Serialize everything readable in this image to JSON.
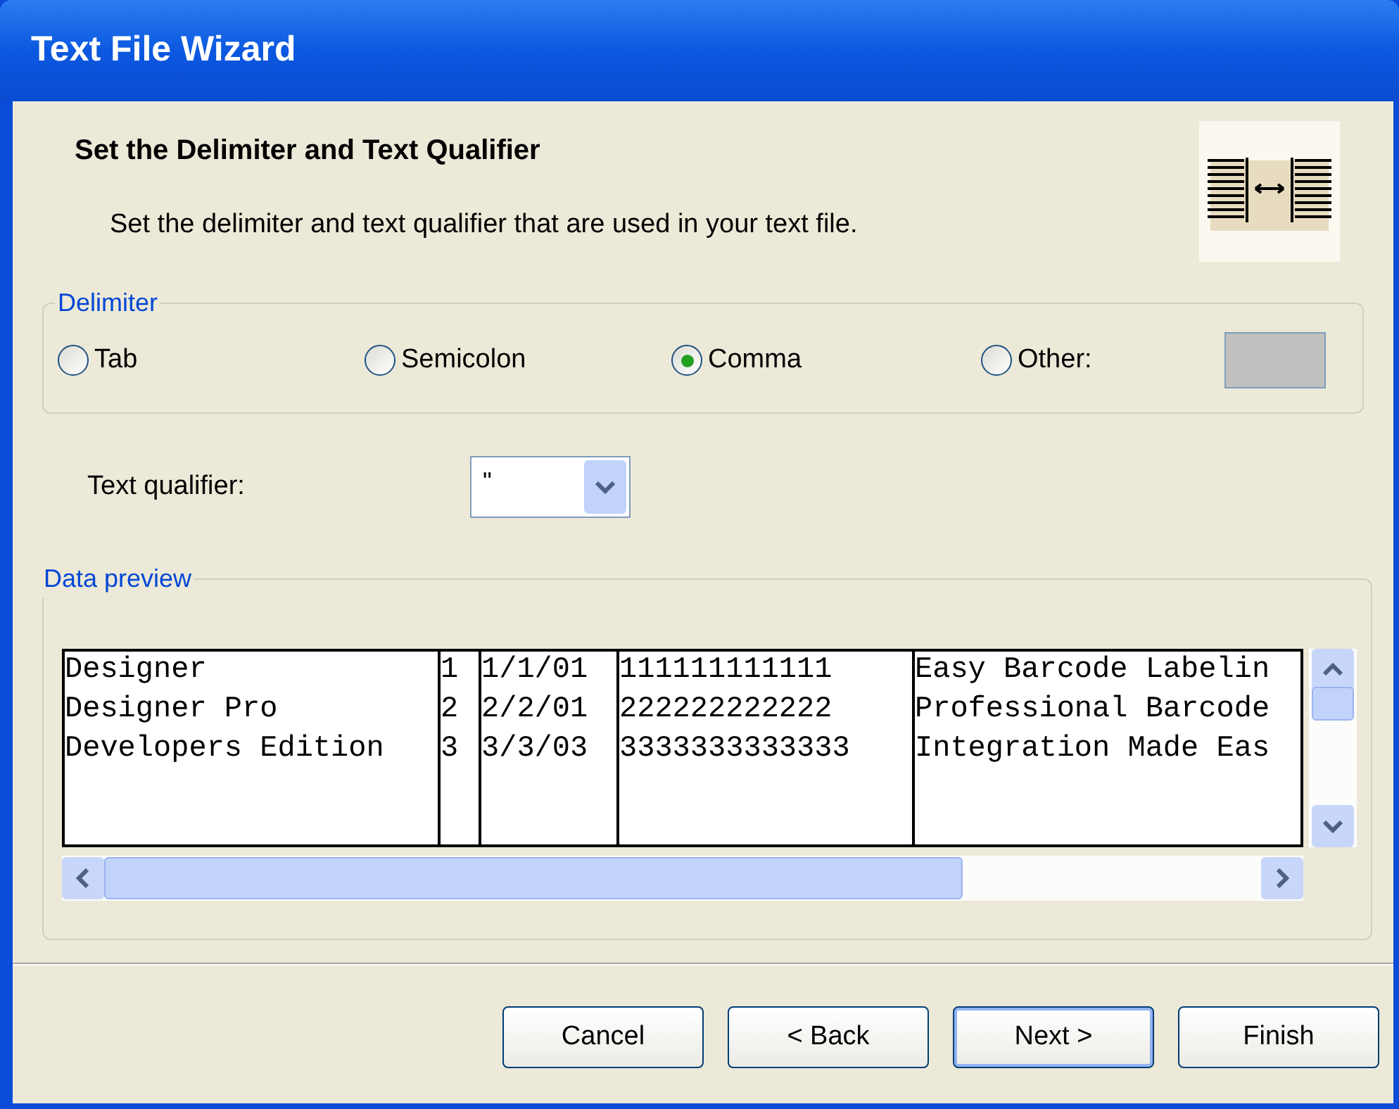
{
  "window": {
    "title": "Text File Wizard"
  },
  "header": {
    "title": "Set the Delimiter and Text Qualifier",
    "description": "Set the delimiter and text qualifier that are used in your text file."
  },
  "delimiter": {
    "label": "Delimiter",
    "options": [
      {
        "label": "Tab",
        "selected": false
      },
      {
        "label": "Semicolon",
        "selected": false
      },
      {
        "label": "Comma",
        "selected": true
      },
      {
        "label": "Other:",
        "selected": false
      }
    ]
  },
  "text_qualifier": {
    "label": "Text qualifier:",
    "value": "\""
  },
  "data_preview": {
    "label": "Data preview",
    "rows": [
      [
        "Designer",
        "1",
        "1/1/01",
        "111111111111",
        "Easy Barcode Labelin"
      ],
      [
        "Designer Pro",
        "2",
        "2/2/01",
        "222222222222",
        "Professional Barcode"
      ],
      [
        "Developers Edition",
        "3",
        "3/3/03",
        "3333333333333",
        "Integration Made Eas"
      ]
    ]
  },
  "buttons": [
    {
      "label": "Cancel",
      "default": false
    },
    {
      "label": "< Back",
      "default": false
    },
    {
      "label": "Next >",
      "default": true
    },
    {
      "label": "Finish",
      "default": false
    }
  ]
}
